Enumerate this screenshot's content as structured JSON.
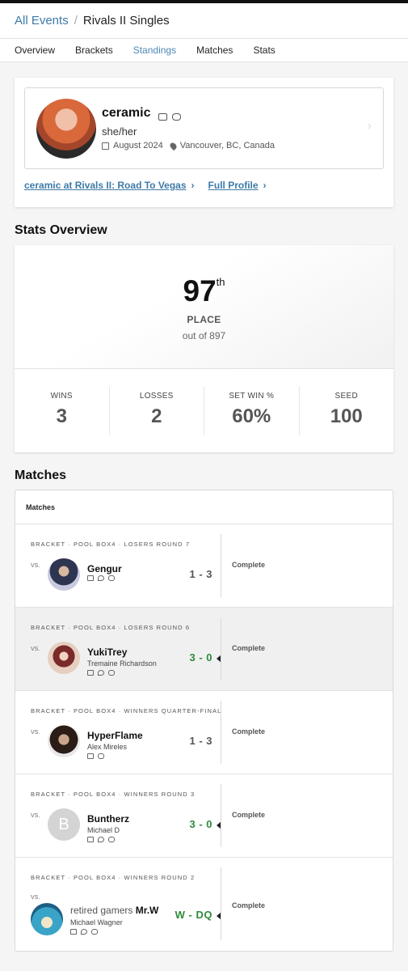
{
  "breadcrumb": {
    "parent": "All Events",
    "separator": "/",
    "current": "Rivals II Singles"
  },
  "tabs": [
    "Overview",
    "Brackets",
    "Standings",
    "Matches",
    "Stats"
  ],
  "active_tab": "Standings",
  "profile": {
    "name": "ceramic",
    "pronouns": "she/her",
    "joined": "August 2024",
    "location": "Vancouver, BC, Canada",
    "icons": [
      "twitch-icon",
      "discord-icon"
    ],
    "links": [
      "ceramic at Rivals II: Road To Vegas",
      "Full Profile"
    ]
  },
  "stats_overview": {
    "title": "Stats Overview",
    "place": "97",
    "place_suffix": "th",
    "place_label": "PLACE",
    "out_of": "out of 897",
    "stats": [
      {
        "label": "WINS",
        "value": "3"
      },
      {
        "label": "LOSSES",
        "value": "2"
      },
      {
        "label": "SET WIN %",
        "value": "60%"
      },
      {
        "label": "SEED",
        "value": "100"
      }
    ]
  },
  "matches": {
    "title": "Matches",
    "header": "Matches",
    "items": [
      {
        "bracket": "BRACKET · POOL BOX4 · LOSERS ROUND 7",
        "vs": "VS.",
        "prefix": "",
        "name": "Gengur",
        "real_name": "",
        "score": "1 - 3",
        "won": false,
        "status": "Complete",
        "icons": [
          "twitch-icon",
          "twitter-icon",
          "discord-icon"
        ]
      },
      {
        "bracket": "BRACKET · POOL BOX4 · LOSERS ROUND 6",
        "vs": "VS.",
        "prefix": "",
        "name": "YukiTrey",
        "real_name": "Tremaine Richardson",
        "score": "3 - 0",
        "won": true,
        "status": "Complete",
        "icons": [
          "twitch-icon",
          "twitter-icon",
          "discord-icon"
        ]
      },
      {
        "bracket": "BRACKET · POOL BOX4 · WINNERS QUARTER-FINAL",
        "vs": "VS.",
        "prefix": "",
        "name": "HyperFlame",
        "real_name": "Alex Mireles",
        "score": "1 - 3",
        "won": false,
        "status": "Complete",
        "icons": [
          "twitch-icon",
          "discord-icon"
        ]
      },
      {
        "bracket": "BRACKET · POOL BOX4 · WINNERS ROUND 3",
        "vs": "VS.",
        "prefix": "",
        "name": "Buntherz",
        "real_name": "Michael D",
        "score": "3 - 0",
        "won": true,
        "status": "Complete",
        "avatar_letter": "B",
        "icons": [
          "twitch-icon",
          "twitter-icon",
          "discord-icon"
        ]
      },
      {
        "bracket": "BRACKET · POOL BOX4 · WINNERS ROUND 2",
        "vs": "VS.",
        "prefix": "retired gamers",
        "name": "Mr.W",
        "real_name": "Michael Wagner",
        "score": "W - DQ",
        "won": true,
        "status": "Complete",
        "icons": [
          "twitch-icon",
          "twitter-icon",
          "discord-icon"
        ]
      }
    ]
  },
  "colors": {
    "link": "#3d7aa8",
    "active_tab": "#4a88b5",
    "win": "#2e8a3e"
  }
}
